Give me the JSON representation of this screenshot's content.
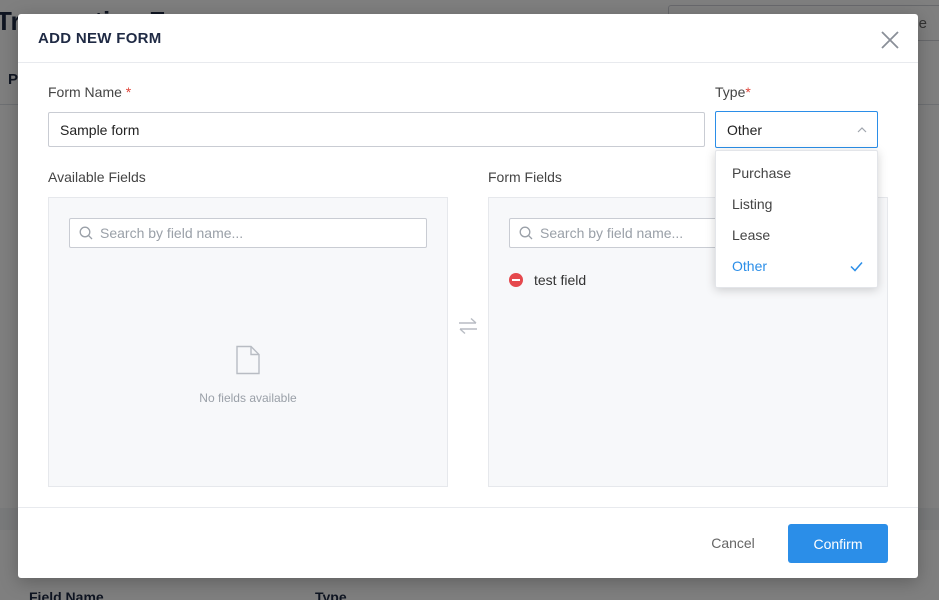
{
  "background": {
    "title": "Transaction Forms",
    "search_fragment": "age",
    "tab_fragment": "P",
    "columns": [
      "Field Name",
      "Type"
    ]
  },
  "modal": {
    "title": "ADD NEW FORM",
    "close_icon": "close-icon"
  },
  "form": {
    "name_label": "Form Name",
    "required_mark": "*",
    "name_value": "Sample form",
    "type_label": "Type",
    "type_value": "Other"
  },
  "type_dropdown": {
    "options": [
      "Purchase",
      "Listing",
      "Lease",
      "Other"
    ],
    "selected": "Other"
  },
  "available_fields": {
    "label": "Available Fields",
    "search_placeholder": "Search by field name...",
    "empty_text": "No fields available"
  },
  "form_fields": {
    "label": "Form Fields",
    "search_placeholder": "Search by field name...",
    "items": [
      "test field"
    ]
  },
  "footer": {
    "cancel_label": "Cancel",
    "confirm_label": "Confirm"
  },
  "colors": {
    "accent": "#2b8ee8",
    "danger": "#e5484d"
  }
}
